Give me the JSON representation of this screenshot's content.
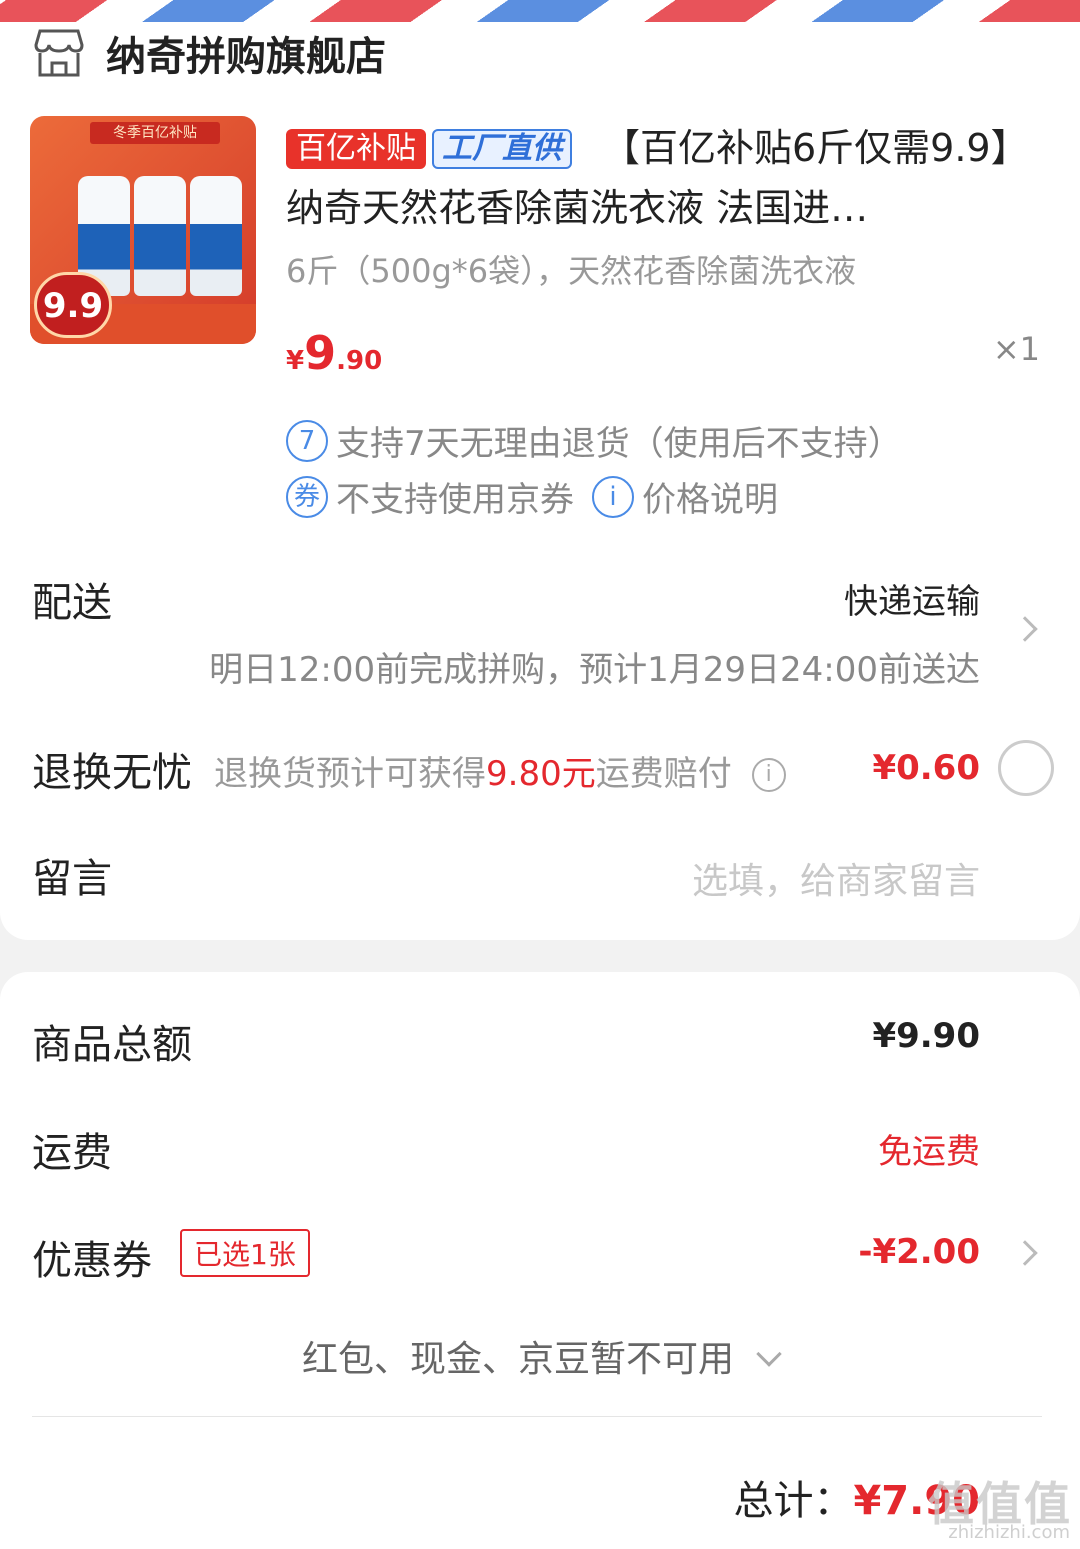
{
  "store": {
    "name": "纳奇拼购旗舰店",
    "icon": "store-icon"
  },
  "product": {
    "tag_subsidy": "百亿补贴",
    "tag_factory": "工厂直供",
    "title": "【百亿补贴6斤仅需9.9】纳奇天然花香除菌洗衣液 法国进…",
    "spec": "6斤（500g*6袋），天然花香除菌洗衣液",
    "price_symbol": "¥",
    "price_int": "9",
    "price_dec": ".90",
    "quantity": "×1",
    "thumb_band": "冬季百亿补贴",
    "thumb_price": "9.9"
  },
  "services": {
    "return_icon": "7",
    "return_text": "支持7天无理由退货（使用后不支持）",
    "coupon_icon": "券",
    "coupon_text": "不支持使用京券",
    "info_icon": "i",
    "price_note": "价格说明"
  },
  "delivery": {
    "label": "配送",
    "method": "快递运输",
    "eta": "明日12:00前完成拼购，预计1月29日24:00前送达"
  },
  "return_worry": {
    "label": "退换无忧",
    "desc_prefix": "退换货预计可获得",
    "desc_amount": "9.80元",
    "desc_suffix": "运费赔付",
    "info_icon": "i",
    "price": "¥0.60"
  },
  "message": {
    "label": "留言",
    "placeholder": "选填，给商家留言"
  },
  "summary": {
    "goods_total_label": "商品总额",
    "goods_total": "¥9.90",
    "shipping_label": "运费",
    "shipping_value": "免运费",
    "coupon_label": "优惠券",
    "coupon_tag": "已选1张",
    "coupon_value": "-¥2.00",
    "unavailable": "红包、现金、京豆暂不可用",
    "total_label": "总计：",
    "total_amount": "¥7.90"
  },
  "watermark": {
    "text": "zhizhizhi.com",
    "logo": "值值值"
  },
  "colors": {
    "accent_red": "#e4282e",
    "link_blue": "#4a8be6"
  }
}
